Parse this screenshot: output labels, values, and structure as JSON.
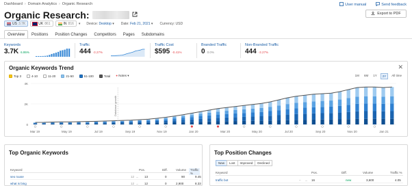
{
  "breadcrumb": [
    "Dashboard",
    "Domain Analytics",
    "Organic Research"
  ],
  "header_links": {
    "user_manual": "User manual",
    "send_feedback": "Send feedback"
  },
  "title": "Organic Research:",
  "export_label": "Export to PDF",
  "databases": [
    {
      "code": "US",
      "count": "3.7K",
      "active": true
    },
    {
      "code": "UK",
      "count": "861",
      "active": false
    },
    {
      "code": "IN",
      "count": "816",
      "active": false
    }
  ],
  "meta": {
    "device_label": "Device:",
    "device": "Desktop",
    "date_label": "Date:",
    "date": "Feb 21, 2021",
    "currency_label": "Currency:",
    "currency": "USD"
  },
  "tabs": [
    "Overview",
    "Positions",
    "Position Changes",
    "Competitors",
    "Pages",
    "Subdomains"
  ],
  "metrics": [
    {
      "label": "Keywords",
      "value": "3.7K",
      "change": "6.95%",
      "trend": "pos"
    },
    {
      "label": "Traffic",
      "value": "444",
      "change": "-3.27%",
      "trend": "neg"
    },
    {
      "label": "Traffic Cost",
      "value": "$595",
      "change": "-0.41%",
      "trend": "neg"
    },
    {
      "label": "Branded Traffic",
      "value": "0",
      "change": "0.0%",
      "trend": "neu"
    },
    {
      "label": "Non-Branded Traffic",
      "value": "444",
      "change": "-3.27%",
      "trend": "neg"
    }
  ],
  "trend": {
    "title": "Organic Keywords Trend",
    "legend": [
      "Top 3",
      "4-10",
      "11-20",
      "21-50",
      "51-100",
      "Total"
    ],
    "notes_label": "Notes",
    "ranges": [
      "1M",
      "6M",
      "1Y",
      "2Y",
      "All time"
    ],
    "active_range": "2Y",
    "annotation": "Database growth"
  },
  "chart_data": {
    "type": "bar",
    "x_ticks": [
      "Mar 19",
      "May 19",
      "Jul 19",
      "Sep 19",
      "Nov 19",
      "Jan 20",
      "Mar 20",
      "May 20",
      "Jul 20",
      "Sep 20",
      "Nov 20",
      "Jan 21"
    ],
    "y_ticks": [
      "0",
      "2K",
      "4K"
    ],
    "ylim": [
      0,
      4000
    ],
    "total_line": [
      200,
      210,
      230,
      250,
      250,
      270,
      290,
      310,
      330,
      360,
      390,
      420,
      470,
      520,
      600,
      700,
      820,
      950,
      1100,
      1250,
      1400,
      1550,
      1650,
      1750,
      1850,
      1950,
      2050,
      2200,
      2400,
      2600,
      2750,
      2850,
      2950,
      3000,
      3050,
      3200,
      3400,
      3600,
      3650,
      3650,
      3600,
      3650
    ],
    "series": [
      {
        "name": "Top 3",
        "values": [
          60,
          60,
          70,
          70,
          70,
          80,
          80,
          90,
          90,
          100,
          110,
          120,
          130,
          140,
          160,
          180,
          200,
          220,
          240,
          260,
          280,
          300,
          320,
          330,
          340,
          350,
          360,
          380,
          400,
          420,
          440,
          460,
          470,
          480,
          490,
          500,
          520,
          540,
          550,
          550,
          540,
          550
        ]
      },
      {
        "name": "4-10",
        "values": [
          50,
          50,
          55,
          60,
          60,
          65,
          70,
          75,
          80,
          85,
          90,
          100,
          110,
          120,
          140,
          160,
          190,
          220,
          250,
          280,
          310,
          340,
          360,
          380,
          400,
          420,
          440,
          470,
          500,
          540,
          570,
          590,
          610,
          620,
          630,
          660,
          700,
          740,
          750,
          750,
          740,
          750
        ]
      },
      {
        "name": "11-20",
        "values": [
          40,
          40,
          45,
          50,
          50,
          55,
          60,
          65,
          70,
          75,
          80,
          85,
          95,
          105,
          120,
          140,
          170,
          200,
          230,
          260,
          290,
          320,
          340,
          360,
          380,
          400,
          420,
          450,
          490,
          530,
          560,
          580,
          600,
          610,
          620,
          650,
          690,
          730,
          740,
          740,
          730,
          740
        ]
      },
      {
        "name": "21-50",
        "values": [
          30,
          35,
          35,
          40,
          40,
          40,
          45,
          45,
          50,
          55,
          60,
          65,
          75,
          85,
          100,
          120,
          140,
          170,
          200,
          230,
          260,
          290,
          310,
          330,
          350,
          370,
          390,
          420,
          460,
          500,
          530,
          550,
          570,
          580,
          590,
          620,
          660,
          700,
          710,
          710,
          700,
          710
        ]
      },
      {
        "name": "51-100",
        "values": [
          20,
          25,
          25,
          30,
          30,
          30,
          35,
          35,
          40,
          45,
          50,
          50,
          60,
          70,
          80,
          100,
          120,
          140,
          180,
          220,
          260,
          300,
          320,
          350,
          380,
          410,
          440,
          480,
          550,
          610,
          650,
          670,
          700,
          710,
          720,
          770,
          830,
          890,
          900,
          900,
          890,
          900
        ]
      }
    ]
  },
  "top_keywords": {
    "title": "Top Organic Keywords",
    "columns": [
      "Keyword",
      "Pos.",
      "Diff.",
      "Volume",
      "Traffic %"
    ],
    "rows": [
      {
        "keyword": "seo ruuse",
        "pos_from": "12",
        "pos_to": "13",
        "diff": "0",
        "volume": "90",
        "traffic": "9.45"
      },
      {
        "keyword": "what is bing",
        "pos_from": "12",
        "pos_to": "12",
        "diff": "0",
        "volume": "2,900",
        "traffic": "8.33"
      }
    ]
  },
  "top_changes": {
    "title": "Top Position Changes",
    "filters": [
      "New",
      "Lost",
      "Improved",
      "Declined"
    ],
    "active_filter": "New",
    "columns": [
      "Keyword",
      "Pos.",
      "Diff.",
      "Volume",
      "Traffic %"
    ],
    "rows": [
      {
        "keyword": "traffic bot",
        "pos": "16",
        "diff": "new",
        "volume": "3,600",
        "traffic": "4.05"
      }
    ]
  },
  "colors": {
    "accent": "#1b5ea6",
    "bar_dark": "#1f73c4",
    "bar_light": "#8cc1ea",
    "line": "#555555"
  }
}
